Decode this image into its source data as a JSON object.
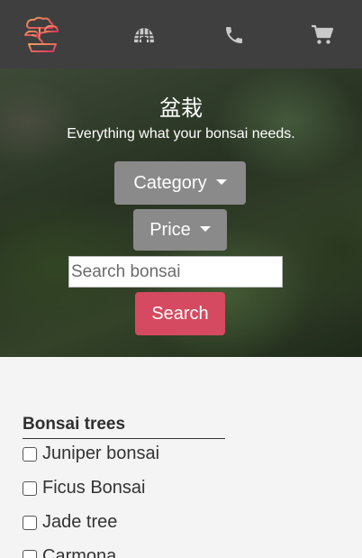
{
  "nav": {
    "logo": "bonsai-logo",
    "icons": [
      "home-icon",
      "phone-icon",
      "cart-icon"
    ],
    "accent": "#e0506a"
  },
  "hero": {
    "title": "盆栽",
    "subtitle": "Everything what your bonsai needs.",
    "category_label": "Category",
    "price_label": "Price",
    "search_placeholder": "Search bonsai",
    "search_button": "Search"
  },
  "filters": {
    "title": "Bonsai trees",
    "items": [
      "Juniper bonsai",
      "Ficus Bonsai",
      "Jade tree",
      "Carmona"
    ]
  },
  "colors": {
    "navbar": "#3f3f3f",
    "dropdown": "#8a8a8a",
    "search_button": "#d54a60"
  }
}
